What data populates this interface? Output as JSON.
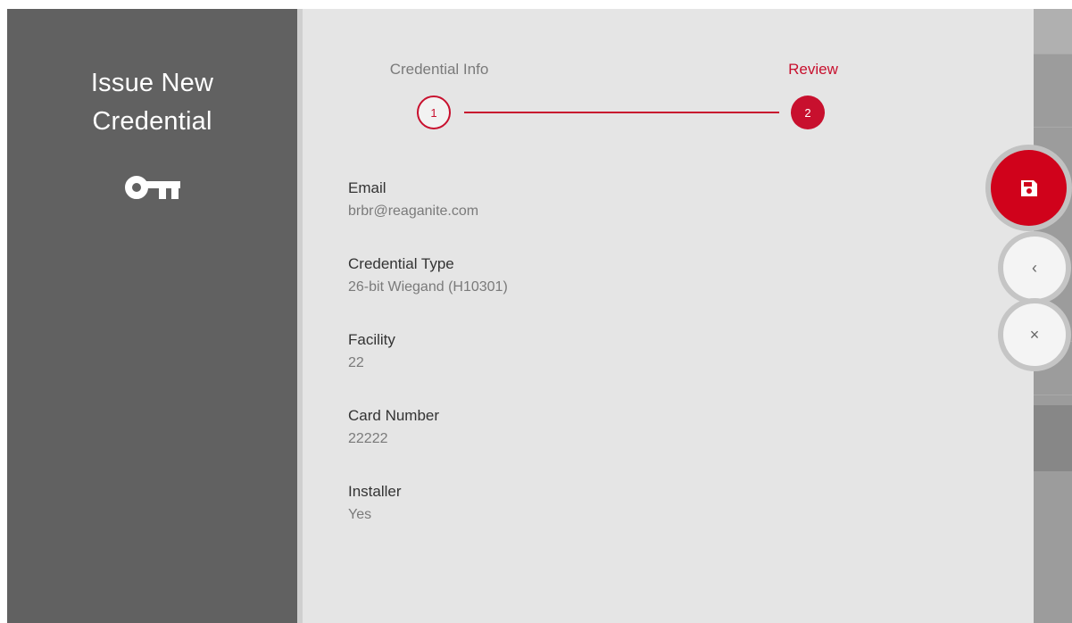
{
  "sidebar": {
    "title_line1": "Issue New",
    "title_line2": "Credential",
    "icon": "key-icon"
  },
  "stepper": {
    "steps": [
      {
        "label": "Credential Info",
        "number": "1",
        "state": "completed"
      },
      {
        "label": "Review",
        "number": "2",
        "state": "current"
      }
    ]
  },
  "fields": [
    {
      "label": "Email",
      "value": "brbr@reaganite.com"
    },
    {
      "label": "Credential Type",
      "value": "26-bit Wiegand (H10301)"
    },
    {
      "label": "Facility",
      "value": "22"
    },
    {
      "label": "Card Number",
      "value": "22222"
    },
    {
      "label": "Installer",
      "value": "Yes"
    }
  ],
  "actions": {
    "save_icon": "floppy-disk-icon",
    "back_glyph": "‹",
    "close_glyph": "×"
  },
  "colors": {
    "accent": "#c8102e",
    "sidebar": "#616161",
    "panel": "#e5e5e5"
  }
}
